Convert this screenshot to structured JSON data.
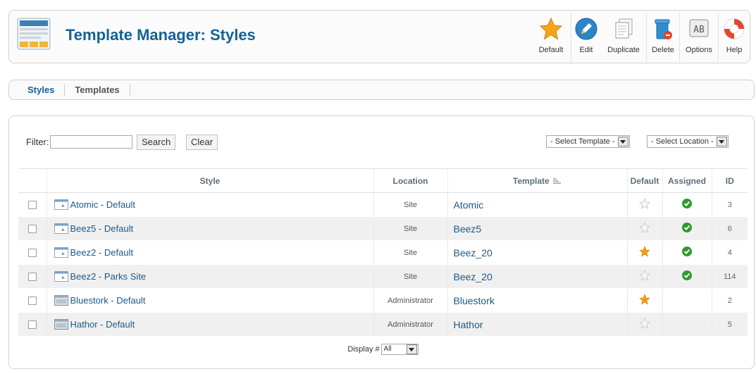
{
  "header": {
    "title": "Template Manager: Styles",
    "toolbar": [
      {
        "label": "Default",
        "icon": "star-icon"
      },
      {
        "label": "Edit",
        "icon": "pencil-icon"
      },
      {
        "label": "Duplicate",
        "icon": "duplicate-icon"
      },
      {
        "label": "Delete",
        "icon": "trash-icon"
      },
      {
        "label": "Options",
        "icon": "options-icon"
      },
      {
        "label": "Help",
        "icon": "lifebuoy-icon"
      }
    ]
  },
  "submenu": {
    "items": [
      {
        "label": "Styles",
        "active": true
      },
      {
        "label": "Templates",
        "active": false
      }
    ]
  },
  "filter": {
    "label": "Filter:",
    "value": "",
    "search_label": "Search",
    "clear_label": "Clear",
    "select_template": "- Select Template -",
    "select_location": "- Select Location -"
  },
  "table": {
    "columns": {
      "style": "Style",
      "location": "Location",
      "template": "Template",
      "default": "Default",
      "assigned": "Assigned",
      "id": "ID"
    },
    "rows": [
      {
        "style": "Atomic - Default",
        "location": "Site",
        "template": "Atomic",
        "default": false,
        "assigned": true,
        "id": "3",
        "type": "site"
      },
      {
        "style": "Beez5 - Default",
        "location": "Site",
        "template": "Beez5",
        "default": false,
        "assigned": true,
        "id": "6",
        "type": "site"
      },
      {
        "style": "Beez2 - Default",
        "location": "Site",
        "template": "Beez_20",
        "default": true,
        "assigned": true,
        "id": "4",
        "type": "site"
      },
      {
        "style": "Beez2 - Parks Site",
        "location": "Site",
        "template": "Beez_20",
        "default": false,
        "assigned": true,
        "id": "114",
        "type": "site"
      },
      {
        "style": "Bluestork - Default",
        "location": "Administrator",
        "template": "Bluestork",
        "default": true,
        "assigned": false,
        "id": "2",
        "type": "admin"
      },
      {
        "style": "Hathor - Default",
        "location": "Administrator",
        "template": "Hathor",
        "default": false,
        "assigned": false,
        "id": "5",
        "type": "admin"
      }
    ],
    "footer": {
      "display_label": "Display #",
      "display_value": "All"
    }
  },
  "colors": {
    "title": "#146295",
    "link": "#1d5a86",
    "star_default": "#f39c12",
    "assigned_green": "#2e9b2e"
  }
}
